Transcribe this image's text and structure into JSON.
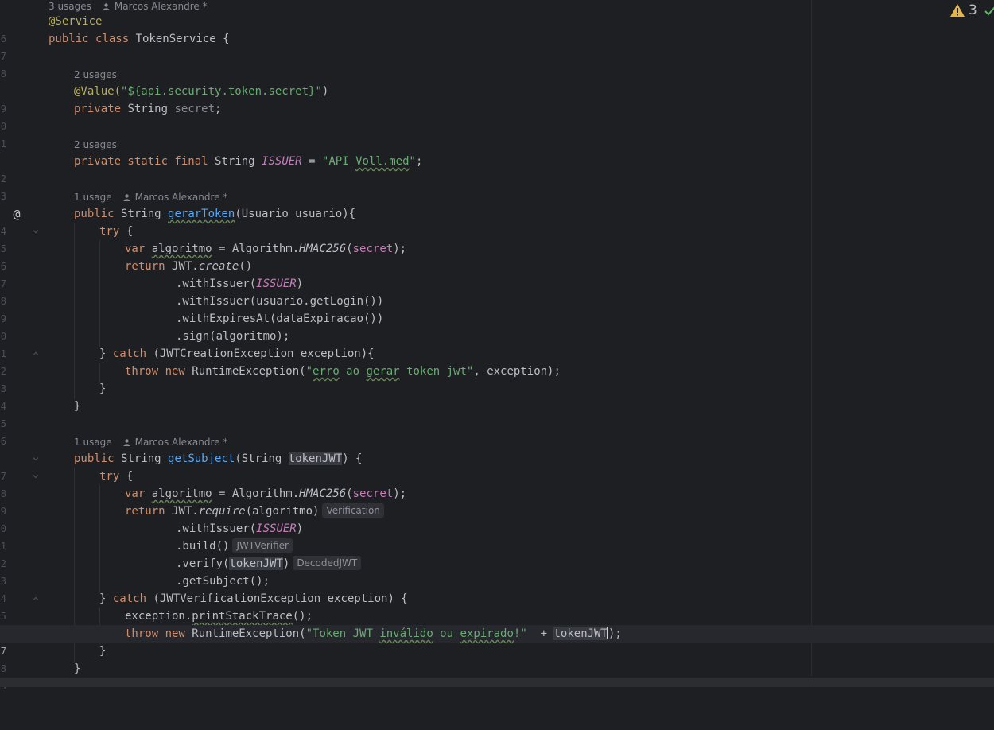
{
  "status": {
    "warning_count": "3"
  },
  "hints": {
    "class_usages": "3 usages",
    "class_author": "Marcos Alexandre *",
    "secret_usages": "2 usages",
    "issuer_usages": "2 usages",
    "gerar_usages": "1 usage",
    "gerar_author": "Marcos Alexandre *",
    "subject_usages": "1 usage",
    "subject_author": "Marcos Alexandre *"
  },
  "chips": {
    "verification": "Verification",
    "jwtverifier": "JWTVerifier",
    "decodedjwt": "DecodedJWT"
  },
  "gutter": [
    "6",
    "7",
    "8",
    "9",
    "0",
    "1",
    "2",
    "3",
    "4",
    "5",
    "6",
    "7",
    "8",
    "9",
    "0",
    "1",
    "2",
    "3",
    "4",
    "5",
    "6",
    "7",
    "8",
    "9",
    "0",
    "1",
    "2",
    "3",
    "4",
    "5",
    "6",
    "7",
    "8",
    "9"
  ],
  "code": {
    "l6": {
      "a": "@Service"
    },
    "l7": {
      "a": "public class ",
      "b": "TokenService {"
    },
    "l9": {
      "a": "@Value(",
      "b": "\"${api.security.token.secret}\"",
      "c": ")"
    },
    "l10": {
      "a": "private ",
      "b": "String ",
      "c": "secret",
      "d": ";"
    },
    "l12": {
      "a": "private static final ",
      "b": "String ",
      "c": "ISSUER",
      "d": " = ",
      "e": "\"API ",
      "f": "Voll.med",
      "g": "\"",
      "h": ";"
    },
    "l14": {
      "a": "public ",
      "b": "String ",
      "c": "gerarToken",
      "d": "(Usuario usuario){"
    },
    "l15": {
      "a": "try ",
      "b": "{"
    },
    "l16": {
      "a": "var ",
      "b": "algoritmo",
      "c": " = Algorithm.",
      "d": "HMAC256",
      "e": "(",
      "f": "secret",
      "g": ");"
    },
    "l17": {
      "a": "return ",
      "b": "JWT.",
      "c": "create",
      "d": "()"
    },
    "l18": {
      "a": ".withIssuer(",
      "b": "ISSUER",
      "c": ")"
    },
    "l19": {
      "a": ".withIssuer(usuario.getLogin())"
    },
    "l20": {
      "a": ".withExpiresAt(dataExpiracao())"
    },
    "l21": {
      "a": ".sign(algoritmo);"
    },
    "l22": {
      "a": "} ",
      "b": "catch ",
      "c": "(JWTCreationException exception){"
    },
    "l23": {
      "a": "throw new ",
      "b": "RuntimeException(",
      "c": "\"",
      "d": "erro",
      "e": " ao ",
      "f": "gerar",
      "g": " token jwt\"",
      "h": ", exception);"
    },
    "l24": {
      "a": "}"
    },
    "l25": {
      "a": "}"
    },
    "l27": {
      "a": "public ",
      "b": "String ",
      "c": "getSubject",
      "d": "(String ",
      "e": "tokenJWT",
      "f": ") {"
    },
    "l28": {
      "a": "try ",
      "b": "{"
    },
    "l29": {
      "a": "var ",
      "b": "algoritmo",
      "c": " = Algorithm.",
      "d": "HMAC256",
      "e": "(",
      "f": "secret",
      "g": ");"
    },
    "l30": {
      "a": "return ",
      "b": "JWT.",
      "c": "require",
      "d": "(algoritmo)"
    },
    "l31": {
      "a": ".withIssuer(",
      "b": "ISSUER",
      "c": ")"
    },
    "l32": {
      "a": ".build()"
    },
    "l33": {
      "a": ".verify(",
      "b": "tokenJWT",
      "c": ")"
    },
    "l34": {
      "a": ".getSubject();"
    },
    "l35": {
      "a": "} ",
      "b": "catch ",
      "c": "(JWTVerificationException exception) {"
    },
    "l36": {
      "a": "exception.",
      "b": "printStackTrace",
      "c": "();"
    },
    "l37": {
      "a": "throw new ",
      "b": "RuntimeException(",
      "c": "\"Token JWT ",
      "d": "inválido",
      "e": " ou ",
      "f": "expirado",
      "g": "!\"",
      "h": "  + ",
      "i": "tokenJWT",
      "j": ")",
      "k": ";"
    },
    "l38": {
      "a": "}"
    },
    "l39": {
      "a": "}"
    }
  }
}
